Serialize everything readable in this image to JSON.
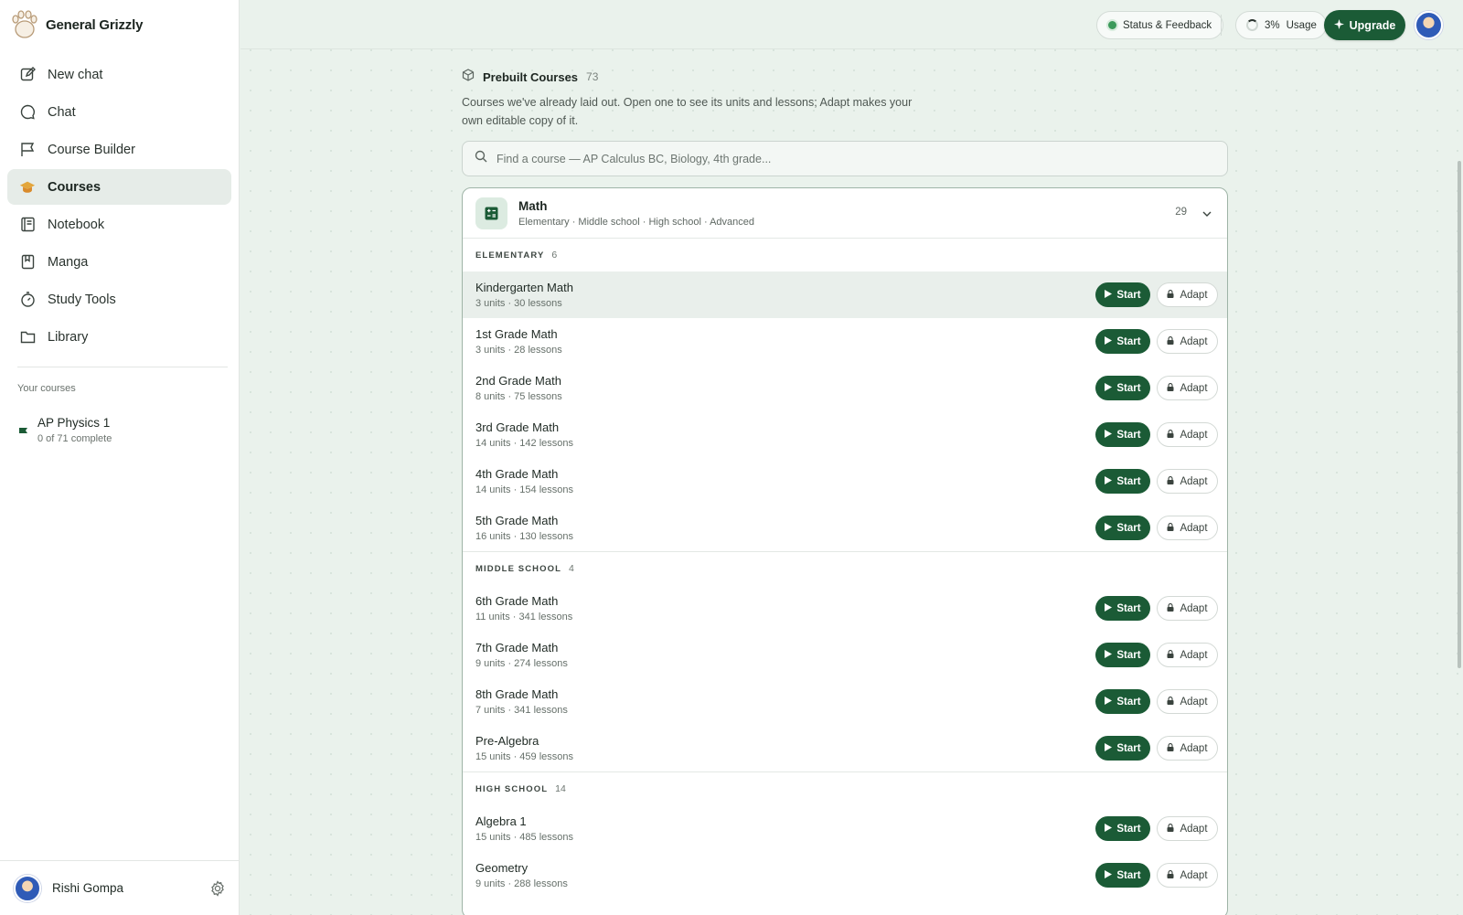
{
  "app": {
    "name": "General Grizzly"
  },
  "sidebar": {
    "items": [
      {
        "label": "New chat",
        "icon": "edit-icon"
      },
      {
        "label": "Chat",
        "icon": "chat-bubble-icon"
      },
      {
        "label": "Course Builder",
        "icon": "flag-icon"
      },
      {
        "label": "Courses",
        "icon": "graduation-cap-icon",
        "active": true
      },
      {
        "label": "Notebook",
        "icon": "notebook-icon"
      },
      {
        "label": "Manga",
        "icon": "book-icon"
      },
      {
        "label": "Study Tools",
        "icon": "stopwatch-icon"
      },
      {
        "label": "Library",
        "icon": "folder-icon"
      }
    ],
    "your_courses_label": "Your courses",
    "your_courses": [
      {
        "title": "AP Physics 1",
        "progress": "0 of 71 complete"
      }
    ],
    "user": {
      "name": "Rishi Gompa"
    }
  },
  "topbar": {
    "status_label": "Status & Feedback",
    "usage_percent": "3%",
    "usage_label": "Usage",
    "upgrade_label": "Upgrade"
  },
  "main": {
    "section_title": "Prebuilt Courses",
    "section_count": "73",
    "section_desc": "Courses we've already laid out. Open one to see its units and lessons; Adapt makes your own editable copy of it.",
    "search_placeholder": "Find a course — AP Calculus BC, Biology, 4th grade...",
    "subject": {
      "name": "Math",
      "levels": "Elementary · Middle school · High school · Advanced",
      "count": "29"
    },
    "start_label": "Start",
    "adapt_label": "Adapt",
    "groups": [
      {
        "label": "ELEMENTARY",
        "count": "6",
        "courses": [
          {
            "title": "Kindergarten Math",
            "meta": "3 units · 30 lessons"
          },
          {
            "title": "1st Grade Math",
            "meta": "3 units · 28 lessons"
          },
          {
            "title": "2nd Grade Math",
            "meta": "8 units · 75 lessons"
          },
          {
            "title": "3rd Grade Math",
            "meta": "14 units · 142 lessons"
          },
          {
            "title": "4th Grade Math",
            "meta": "14 units · 154 lessons"
          },
          {
            "title": "5th Grade Math",
            "meta": "16 units · 130 lessons"
          }
        ]
      },
      {
        "label": "MIDDLE SCHOOL",
        "count": "4",
        "courses": [
          {
            "title": "6th Grade Math",
            "meta": "11 units · 341 lessons"
          },
          {
            "title": "7th Grade Math",
            "meta": "9 units · 274 lessons"
          },
          {
            "title": "8th Grade Math",
            "meta": "7 units · 341 lessons"
          },
          {
            "title": "Pre-Algebra",
            "meta": "15 units · 459 lessons"
          }
        ]
      },
      {
        "label": "HIGH SCHOOL",
        "count": "14",
        "courses": [
          {
            "title": "Algebra 1",
            "meta": "15 units · 485 lessons"
          },
          {
            "title": "Geometry",
            "meta": "9 units · 288 lessons"
          }
        ]
      }
    ]
  },
  "colors": {
    "accent": "#1b5b36",
    "background": "#eaf2ec",
    "status": "#3c9a5b"
  }
}
